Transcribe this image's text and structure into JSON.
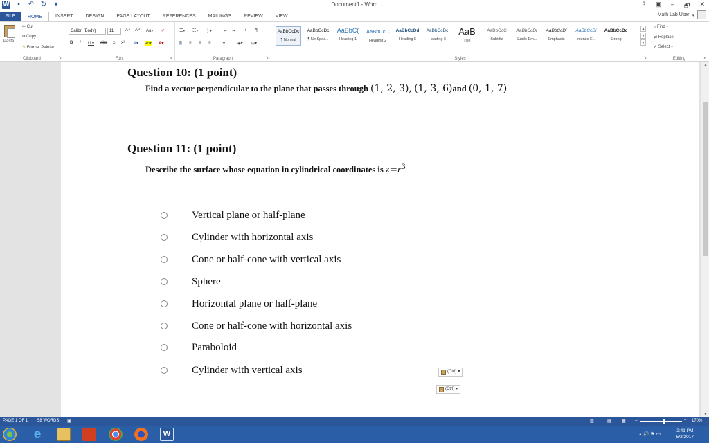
{
  "window": {
    "title": "Document1 - Word",
    "controls": [
      "?",
      "▣",
      "–",
      "🗗",
      "✕"
    ]
  },
  "tabs": [
    "FILE",
    "HOME",
    "INSERT",
    "DESIGN",
    "PAGE LAYOUT",
    "REFERENCES",
    "MAILINGS",
    "REVIEW",
    "VIEW"
  ],
  "user": {
    "name": "Math Lab User"
  },
  "ribbon": {
    "clipboard": {
      "paste": "Paste",
      "cut": "Cut",
      "copy": "Copy",
      "format_painter": "Format Painter",
      "label": "Clipboard"
    },
    "font": {
      "name": "Calibri (Body)",
      "size": "11",
      "label": "Font"
    },
    "paragraph": {
      "label": "Paragraph"
    },
    "styles": {
      "label": "Styles",
      "items": [
        {
          "sample": "AaBbCcDc",
          "name": "¶ Normal"
        },
        {
          "sample": "AaBbCcDc",
          "name": "¶ No Spac..."
        },
        {
          "sample": "AaBbC(",
          "name": "Heading 1"
        },
        {
          "sample": "AaBbCcC",
          "name": "Heading 2"
        },
        {
          "sample": "AaBbCcDd",
          "name": "Heading 5"
        },
        {
          "sample": "AaBbCcDc",
          "name": "Heading 6"
        },
        {
          "sample": "AaB",
          "name": "Title"
        },
        {
          "sample": "AaBbCcC",
          "name": "Subtitle"
        },
        {
          "sample": "AaBbCcDi",
          "name": "Subtle Em..."
        },
        {
          "sample": "AaBbCcDi",
          "name": "Emphasis"
        },
        {
          "sample": "AaBbCcDi",
          "name": "Intense E..."
        },
        {
          "sample": "AaBbCcDc",
          "name": "Strong"
        }
      ]
    },
    "editing": {
      "find": "Find",
      "replace": "Replace",
      "select": "Select",
      "label": "Editing"
    }
  },
  "document": {
    "q10": {
      "title": "Question 10: (1 point)",
      "prompt": "Find a vector perpendicular to the plane that passes through",
      "p1": "(1, 2, 3),",
      "p2": "(1, 3, 6)",
      "and": "and",
      "p3": "(0, 1, 7)"
    },
    "q11": {
      "title": "Question 11: (1 point)",
      "prompt": "Describe the surface whose equation in cylindrical coordinates is",
      "eq_lhs": "z",
      "eq_op": "=",
      "eq_rhs": "r",
      "eq_exp": "3",
      "options": [
        "Vertical plane or half-plane",
        "Cylinder with horizontal axis",
        "Cone or half-cone with vertical axis",
        "Sphere",
        "Horizontal plane or half-plane",
        "Cone or half-cone with horizontal axis",
        "Paraboloid",
        "Cylinder with vertical axis"
      ]
    },
    "paste_options_label": "(Ctrl)"
  },
  "status": {
    "page": "PAGE 1 OF 1",
    "words": "58 WORDS",
    "zoom": "170%"
  },
  "taskbar": {
    "time": "2:41 PM",
    "date": "5/2/2017"
  },
  "colors": {
    "word_blue": "#2b579a",
    "taskbar": "#2a5fa8"
  }
}
